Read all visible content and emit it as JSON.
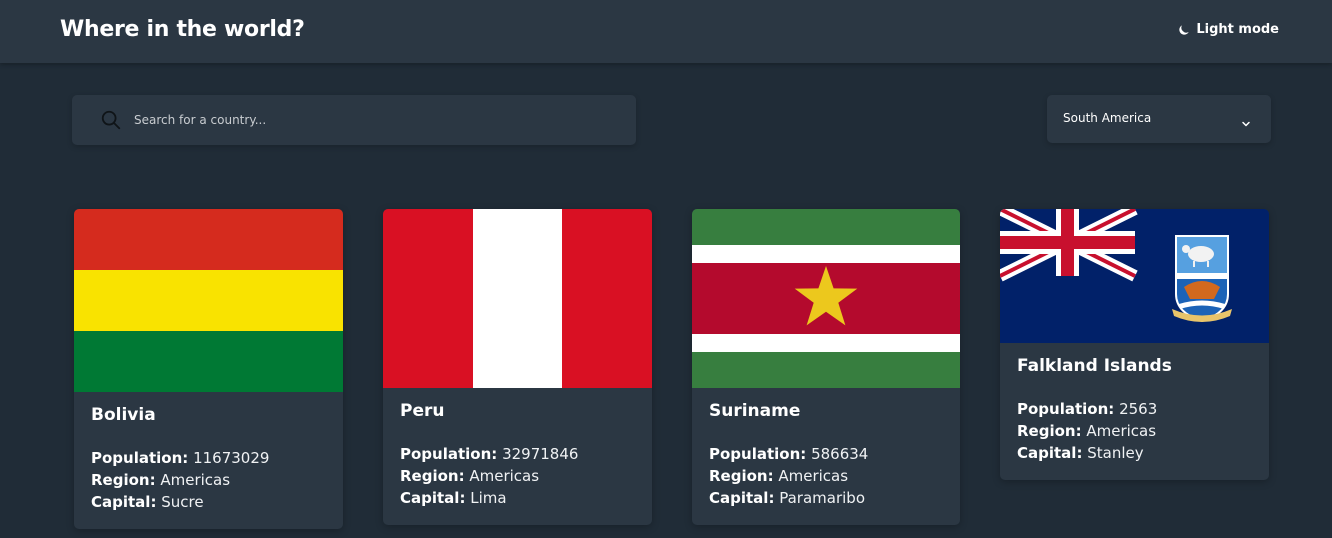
{
  "header": {
    "title": "Where in the world?",
    "theme_toggle_label": "Light mode",
    "theme_icon": "moon-icon"
  },
  "search": {
    "placeholder": "Search for a country...",
    "value": "",
    "icon": "search-icon"
  },
  "filter": {
    "selected": "South America",
    "icon": "chevron-down-icon"
  },
  "labels": {
    "population": "Population:",
    "region": "Region:",
    "capital": "Capital:"
  },
  "countries": [
    {
      "name": "Bolivia",
      "population": "11673029",
      "region": "Americas",
      "capital": "Sucre",
      "flag_colors": [
        "#d52b1e",
        "#f9e300",
        "#007934"
      ]
    },
    {
      "name": "Peru",
      "population": "32971846",
      "region": "Americas",
      "capital": "Lima",
      "flag_colors": [
        "#d91023",
        "#ffffff",
        "#d91023"
      ]
    },
    {
      "name": "Suriname",
      "population": "586634",
      "region": "Americas",
      "capital": "Paramaribo",
      "flag_colors": [
        "#377e3f",
        "#ffffff",
        "#b40a2d",
        "#ecc81d"
      ]
    },
    {
      "name": "Falkland Islands",
      "population": "2563",
      "region": "Americas",
      "capital": "Stanley",
      "flag_colors": [
        "#012169",
        "#c8102e",
        "#ffffff"
      ]
    }
  ],
  "colors": {
    "background": "#202c37",
    "surface": "#2b3743",
    "text": "#ffffff"
  }
}
